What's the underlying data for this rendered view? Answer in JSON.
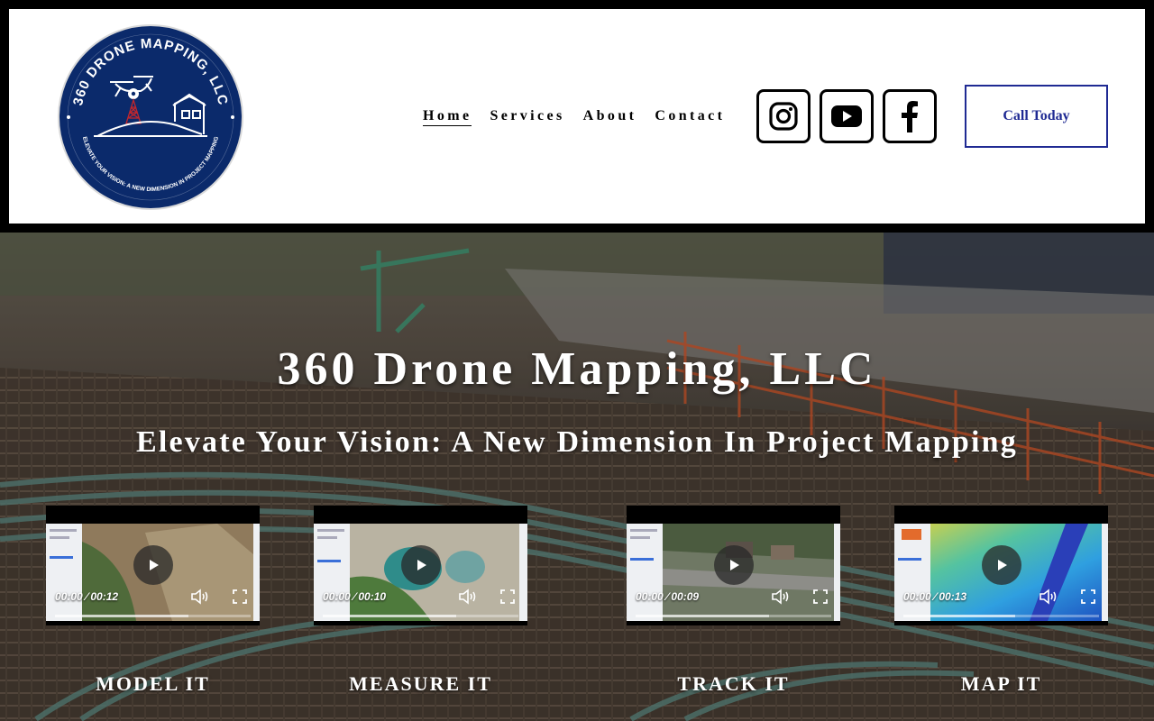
{
  "header": {
    "logo": {
      "ring_text": "360 DRONE MAPPING, LLC",
      "bottom_text": "ELEVATE YOUR VISION: A NEW DIMENSION IN PROJECT MAPPING",
      "color": "#0b2a6b"
    },
    "nav": [
      {
        "label": "Home",
        "active": true
      },
      {
        "label": "Services",
        "active": false
      },
      {
        "label": "About",
        "active": false
      },
      {
        "label": "Contact",
        "active": false
      }
    ],
    "socials": [
      {
        "icon": "instagram-icon"
      },
      {
        "icon": "youtube-icon"
      },
      {
        "icon": "facebook-icon"
      }
    ],
    "cta_label": "Call Today",
    "cta_color": "#1f2a93"
  },
  "hero": {
    "title": "360 Drone Mapping, LLC",
    "subtitle": "Elevate Your Vision: A New Dimension In Project Mapping"
  },
  "videos": [
    {
      "time": "00:00 ⁄ 00:12",
      "label": "MODEL IT",
      "buffered": 0.68
    },
    {
      "time": "00:00 ⁄ 00:10",
      "label": "MEASURE IT",
      "buffered": 0.68
    },
    {
      "time": "00:00 ⁄ 00:09",
      "label": "TRACK IT",
      "buffered": 0.68
    },
    {
      "time": "00:00 ⁄ 00:13",
      "label": "MAP IT",
      "buffered": 0.57
    }
  ]
}
